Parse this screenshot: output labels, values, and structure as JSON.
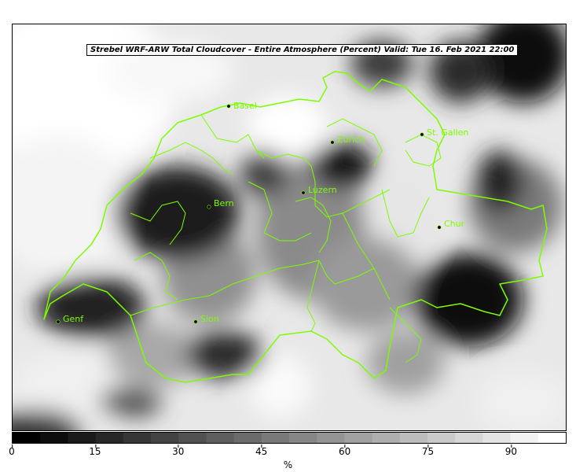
{
  "title": "Strebel WRF-ARW Total Cloudcover - Entire Atmosphere (Percent)   Valid: Tue 16. Feb 2021 22:00",
  "colorbar": {
    "unit": "%",
    "min": 0,
    "max": 100,
    "ticks": [
      "0",
      "15",
      "30",
      "45",
      "60",
      "75",
      "90"
    ],
    "tick_values": [
      0,
      15,
      30,
      45,
      60,
      75,
      90
    ],
    "levels": 20,
    "color_low": "#000000",
    "color_high": "#ffffff"
  },
  "border_color": "#7cfc00",
  "cities": [
    {
      "name": "Basel",
      "key": "basel"
    },
    {
      "name": "Zürich",
      "key": "zurich"
    },
    {
      "name": "St. Gallen",
      "key": "stgallen"
    },
    {
      "name": "Luzern",
      "key": "luzern"
    },
    {
      "name": "Bern",
      "key": "bern"
    },
    {
      "name": "Chur",
      "key": "chur"
    },
    {
      "name": "Sion",
      "key": "sion"
    },
    {
      "name": "Genf",
      "key": "genf"
    }
  ]
}
